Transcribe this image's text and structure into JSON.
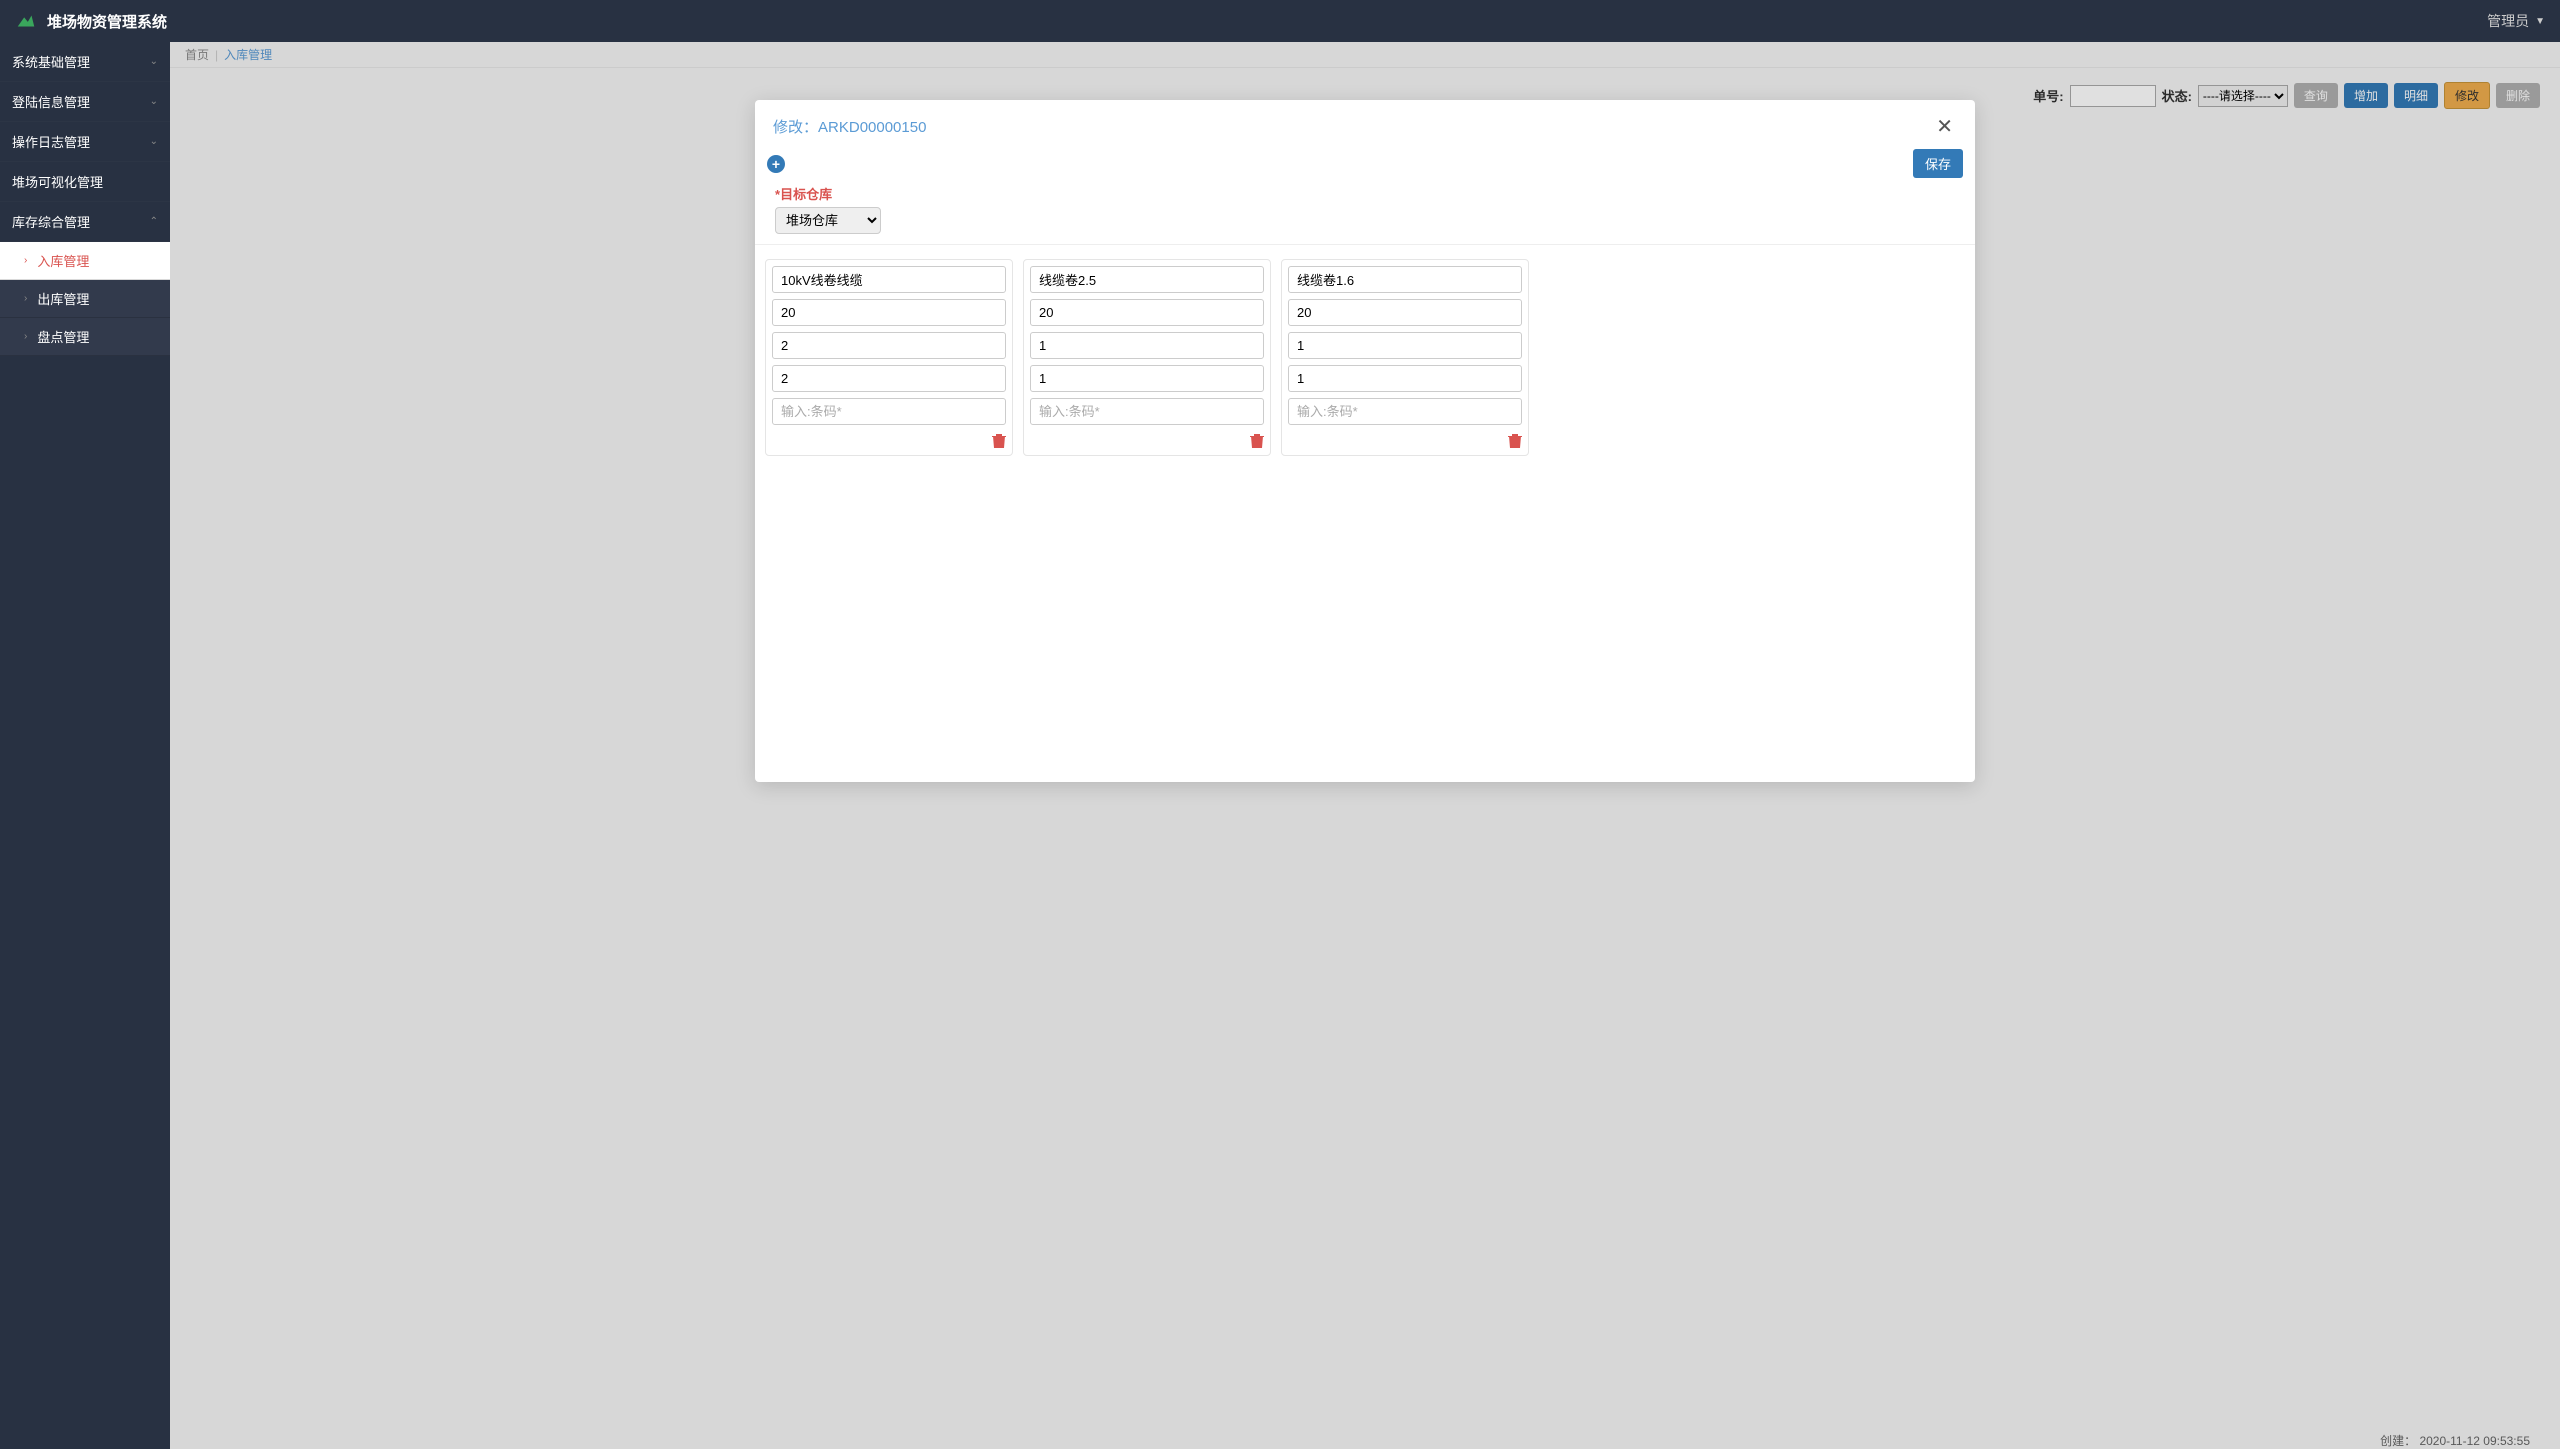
{
  "app": {
    "title": "堆场物资管理系统"
  },
  "user": {
    "label": "管理员"
  },
  "sidebar": {
    "groups": [
      {
        "label": "系统基础管理",
        "expanded": false
      },
      {
        "label": "登陆信息管理",
        "expanded": false
      },
      {
        "label": "操作日志管理",
        "expanded": false
      },
      {
        "label": "堆场可视化管理",
        "expanded": false
      },
      {
        "label": "库存综合管理",
        "expanded": true
      }
    ],
    "sub": [
      {
        "label": "入库管理",
        "active": true
      },
      {
        "label": "出库管理",
        "active": false
      },
      {
        "label": "盘点管理",
        "active": false
      }
    ]
  },
  "breadcrumb": {
    "home": "首页",
    "current": "入库管理"
  },
  "toolbar": {
    "order_label": "单号:",
    "order_value": "",
    "status_label": "状态:",
    "status_placeholder": "----请选择----",
    "buttons": {
      "query": "查询",
      "add": "增加",
      "detail": "明细",
      "edit": "修改",
      "refresh": "删除"
    }
  },
  "modal": {
    "title_prefix": "修改：",
    "record_id": "ARKD00000150",
    "save_label": "保存",
    "target_label": "目标仓库",
    "target_asterisk": "*",
    "target_value": "堆场仓库",
    "barcode_placeholder": "输入:条码*",
    "cards": [
      {
        "name": "10kV线卷线缆",
        "v1": "20",
        "v2": "2",
        "v3": "2",
        "barcode": ""
      },
      {
        "name": "线缆卷2.5",
        "v1": "20",
        "v2": "1",
        "v3": "1",
        "barcode": ""
      },
      {
        "name": "线缆卷1.6",
        "v1": "20",
        "v2": "1",
        "v3": "1",
        "barcode": ""
      }
    ]
  },
  "bottom": {
    "created_label": "创建：",
    "created_value": "2020-11-12 09:53:55"
  }
}
